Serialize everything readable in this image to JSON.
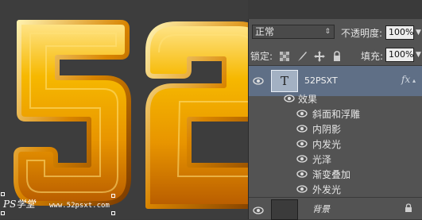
{
  "canvas": {
    "text": "52",
    "watermark_logo": "PS学堂",
    "watermark_url": "www.52psxt.com"
  },
  "layers_panel": {
    "blend_mode": "正常",
    "opacity_label": "不透明度:",
    "opacity_value": "100%",
    "lock_label": "锁定:",
    "fill_label": "填充:",
    "fill_value": "100%",
    "layers": [
      {
        "name": "52PSXT",
        "kind": "text",
        "thumb_glyph": "T",
        "fx_label": "fx",
        "selected": true,
        "effects_label": "效果",
        "effects": [
          "斜面和浮雕",
          "内阴影",
          "内发光",
          "光泽",
          "渐变叠加",
          "外发光"
        ]
      },
      {
        "name": "背景",
        "kind": "background",
        "locked": true
      }
    ]
  },
  "colors": {
    "panel_bg": "#535353",
    "selected_layer": "#5f6f86",
    "gold_light": "#ffd64a",
    "gold_dark": "#c96b00"
  }
}
